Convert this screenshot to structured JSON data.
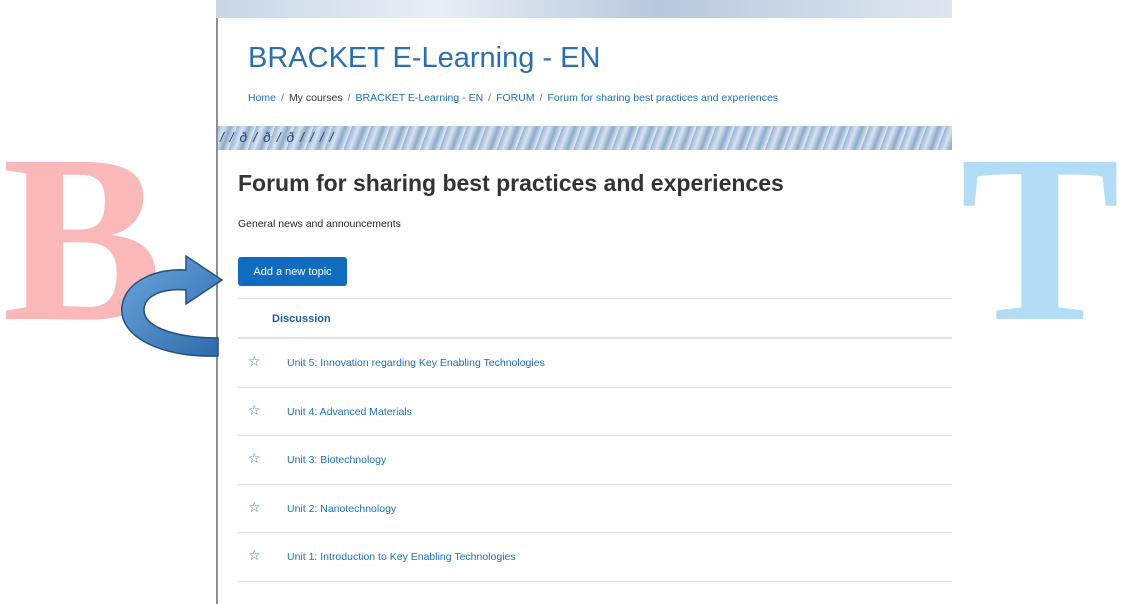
{
  "course": {
    "title": "BRACKET E-Learning - EN"
  },
  "breadcrumb": [
    {
      "label": "Home",
      "link": true
    },
    {
      "label": "My courses",
      "link": false
    },
    {
      "label": "BRACKET E-Learning - EN",
      "link": true
    },
    {
      "label": "FORUM",
      "link": true
    },
    {
      "label": "Forum for sharing best practices and experiences",
      "link": true
    }
  ],
  "forum": {
    "title": "Forum for sharing best practices and experiences",
    "intro": "General news and announcements",
    "add_button": "Add a new topic",
    "column_header": "Discussion"
  },
  "discussions": [
    {
      "title": "Unit 5: Innovation regarding Key Enabling Technologies",
      "icon": "star-outline-icon"
    },
    {
      "title": "Unit 4: Advanced Materials",
      "icon": "star-outline-icon"
    },
    {
      "title": "Unit 3: Biotechnology",
      "icon": "star-outline-icon"
    },
    {
      "title": "Unit 2: Nanotechnology",
      "icon": "star-outline-icon"
    },
    {
      "title": "Unit 1: Introduction to Key Enabling Technologies",
      "icon": "star-outline-icon"
    }
  ],
  "watermark": {
    "left_letter": "B",
    "right_letter": "T",
    "left_color": "#fbb8b8",
    "right_color": "#b3ddf7"
  },
  "colors": {
    "accent": "#0f6cbf",
    "link": "#1a6fc0",
    "title": "#2b6faf",
    "arrow": "#4a89c8"
  }
}
